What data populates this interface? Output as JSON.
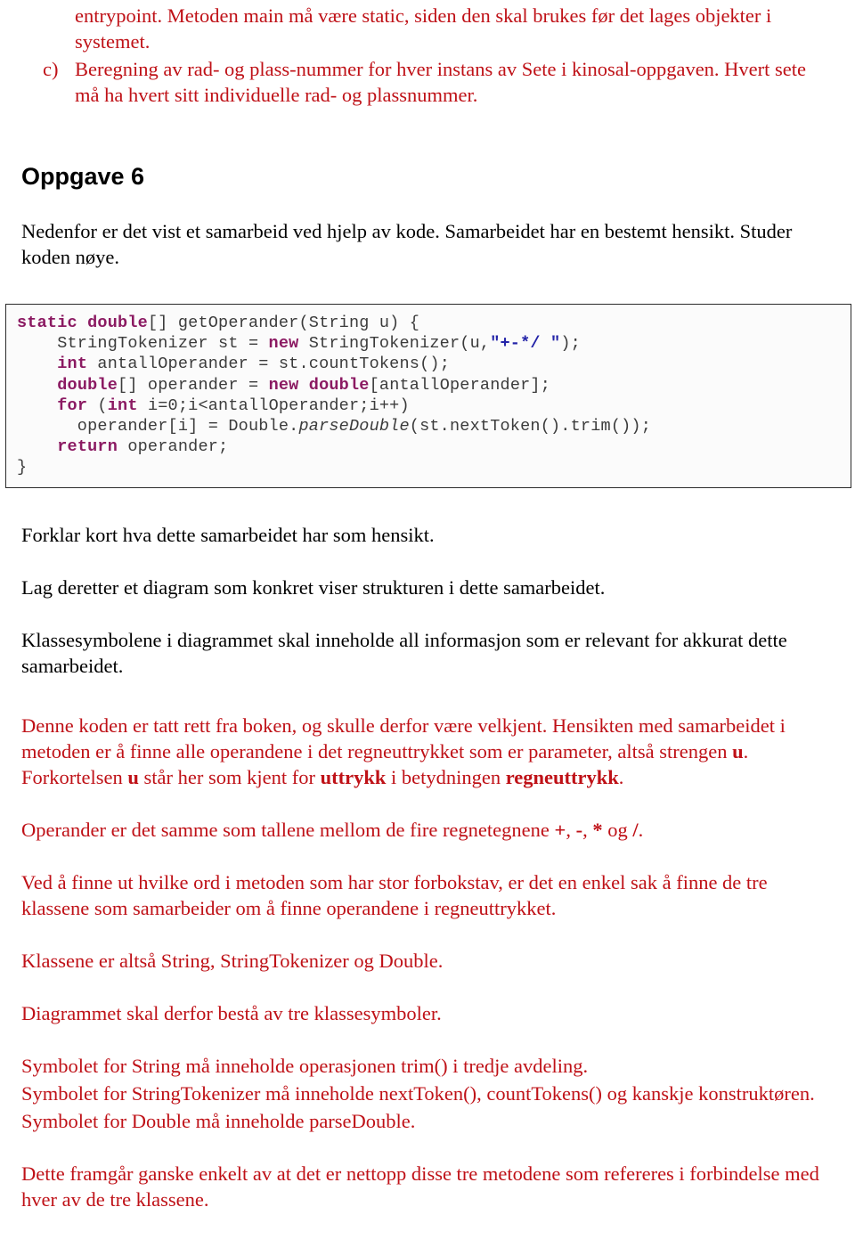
{
  "document": {
    "language": "Norwegian",
    "text_color_answer": "#bf1117",
    "text_color_body": "#000000"
  },
  "top_section": {
    "continuation_paragraph": "entrypoint. Metoden main må være static, siden den skal brukes før det lages objekter i systemet.",
    "list_item": {
      "marker": "c)",
      "text": "Beregning av rad- og plass-nummer for hver instans av Sete i kinosal-oppgaven. Hvert sete må ha hvert sitt individuelle rad- og plassnummer."
    }
  },
  "heading": {
    "title": "Oppgave 6"
  },
  "intro": {
    "paragraph": "Nedenfor er det vist et samarbeid ved hjelp av kode. Samarbeidet har en bestemt hensikt. Studer koden nøye."
  },
  "code_block": {
    "language": "Java",
    "keyword_color": "#8b1a62",
    "string_color": "#2424a8",
    "text_color": "#3b3b3b",
    "border_color": "#2b2b2b",
    "lines": [
      "static double[] getOperander(String u) {",
      "    StringTokenizer st = new StringTokenizer(u,\"+-*/ \");",
      "    int antallOperander = st.countTokens();",
      "    double[] operander = new double[antallOperander];",
      "    for (int i=0;i<antallOperander;i++)",
      "      operander[i] = Double.parseDouble(st.nextToken().trim());",
      "    return operander;",
      "}"
    ],
    "keywords": [
      "static",
      "double",
      "new",
      "int",
      "for",
      "return"
    ],
    "string_literal": "\"+-*/ \"",
    "italic_identifier": "parseDouble"
  },
  "questions": {
    "q1": "Forklar kort hva dette samarbeidet har som hensikt.",
    "q2": "Lag deretter et diagram som konkret viser strukturen i dette samarbeidet.",
    "q3": "Klassesymbolene i diagrammet skal inneholde all informasjon som er relevant for akkurat dette samarbeidet."
  },
  "answer": {
    "p1_part1": "Denne koden er tatt rett fra boken, og skulle derfor være velkjent. Hensikten med samarbeidet i metoden er å finne alle operandene i det regneuttrykket som er parameter, altså strengen ",
    "p1_bold_u1": "u",
    "p1_part2": ". Forkortelsen ",
    "p1_bold_u2": "u",
    "p1_part3": " står her som kjent for ",
    "p1_bold_uttrykk": "uttrykk",
    "p1_part4": " i betydningen ",
    "p1_bold_regneuttrykk": "regneuttrykk",
    "p1_part5": ".",
    "p2_part1": "Operander er det samme som tallene mellom de fire regnetegnene ",
    "p2_op_plus": "+",
    "p2_sep1": ", ",
    "p2_op_minus": "-",
    "p2_sep2": ", ",
    "p2_op_star": "*",
    "p2_sep3": " og ",
    "p2_op_slash": "/",
    "p2_part_end": ".",
    "p3": "Ved å finne ut hvilke ord i metoden som har stor forbokstav, er det en enkel sak å finne de tre klassene som samarbeider om å finne operandene i regneuttrykket.",
    "p4": "Klassene er altså String, StringTokenizer og Double.",
    "p5": "Diagrammet skal derfor bestå av tre klassesymboler.",
    "p6_line1": "Symbolet for String må inneholde operasjonen trim() i tredje avdeling.",
    "p6_line2": "Symbolet for StringTokenizer må inneholde nextToken(), countTokens() og kanskje konstruktøren.",
    "p6_line3": "Symbolet for Double må inneholde parseDouble.",
    "p7": "Dette framgår ganske enkelt av at det er nettopp disse tre metodene som refereres i forbindelse med hver av de tre klassene."
  }
}
